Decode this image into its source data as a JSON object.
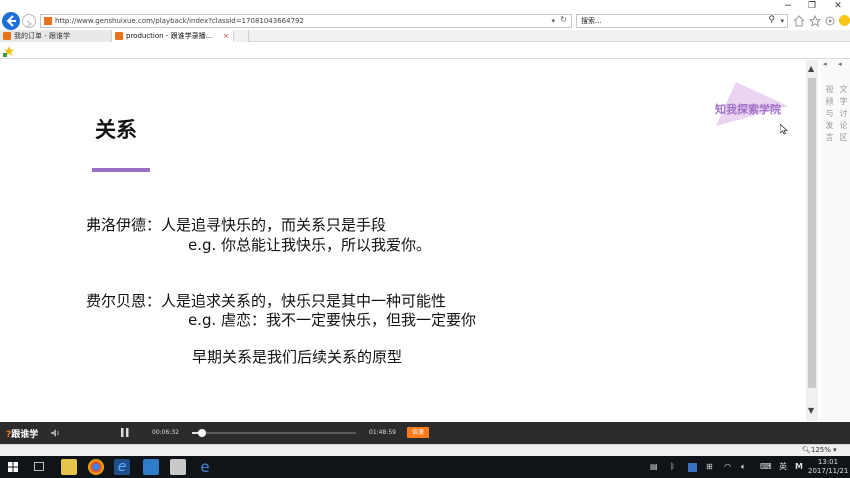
{
  "browser": {
    "window_controls": {
      "minimize": "−",
      "restore": "❐",
      "close": "✕"
    },
    "address_url": "http://www.genshuixue.com/playback/index?classid=17081043664792",
    "search_placeholder": "搜索...",
    "tabs": [
      {
        "label": "我的订单 - 跟谁学",
        "active": false
      },
      {
        "label": "production - 跟谁学录播...",
        "active": true,
        "close": "×"
      }
    ]
  },
  "slide": {
    "title": "关系",
    "watermark": "知我探索学院",
    "lines": [
      "弗洛伊德：人是追寻快乐的，而关系只是手段",
      "e.g. 你总能让我快乐，所以我爱你。",
      "费尔贝恩：人是追求关系的，快乐只是其中一种可能性",
      "e.g. 虐恋：我不一定要快乐，但我一定要你",
      "早期关系是我们后续关系的原型"
    ],
    "accent_color": "#9b6fc8"
  },
  "side_panel": {
    "col1": "视频与发言",
    "col2": "文字讨论区"
  },
  "player": {
    "brand": "跟谁学",
    "current_time": "00:06:32",
    "total_time": "01:48:59",
    "progress": 0.06,
    "speed_button": "倍速"
  },
  "status": {
    "zoom": "125%"
  },
  "taskbar": {
    "ime": "英",
    "time": "13:01",
    "date": "2017/11/21"
  }
}
